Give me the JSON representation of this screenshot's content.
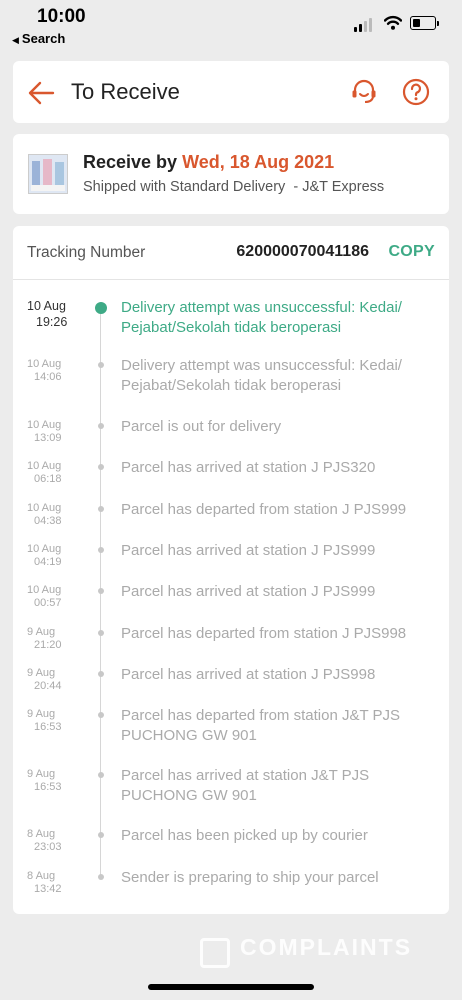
{
  "status_bar": {
    "time": "10:00",
    "back_app_label": "Search",
    "icons": [
      "cellular-signal-icon",
      "wifi-icon",
      "battery-icon"
    ]
  },
  "header": {
    "title": "To Receive",
    "back_icon": "back-arrow-icon",
    "chat_icon": "customer-service-headset-icon",
    "help_icon": "help-question-icon"
  },
  "receive": {
    "label": "Receive by",
    "date": "Wed, 18 Aug 2021",
    "shipping": "Shipped with Standard Delivery  - J&T Express"
  },
  "tracking": {
    "label": "Tracking Number",
    "number": "620000070041186",
    "copy_label": "COPY",
    "events": [
      {
        "date": "10 Aug",
        "time": "19:26",
        "text": "Delivery attempt was unsuccessful: Kedai/ Pejabat/Sekolah tidak beroperasi"
      },
      {
        "date": "10 Aug",
        "time": "14:06",
        "text": "Delivery attempt was unsuccessful: Kedai/ Pejabat/Sekolah tidak beroperasi"
      },
      {
        "date": "10 Aug",
        "time": "13:09",
        "text": "Parcel is out for delivery"
      },
      {
        "date": "10 Aug",
        "time": "06:18",
        "text": "Parcel has arrived at station J PJS320"
      },
      {
        "date": "10 Aug",
        "time": "04:38",
        "text": "Parcel has departed from station J PJS999"
      },
      {
        "date": "10 Aug",
        "time": "04:19",
        "text": "Parcel has arrived at station J PJS999"
      },
      {
        "date": "10 Aug",
        "time": "00:57",
        "text": "Parcel has arrived at station J PJS999"
      },
      {
        "date": "9 Aug",
        "time": "21:20",
        "text": "Parcel has departed from station J PJS998"
      },
      {
        "date": "9 Aug",
        "time": "20:44",
        "text": "Parcel has arrived at station J PJS998"
      },
      {
        "date": "9 Aug",
        "time": "16:53",
        "text": "Parcel has departed from station J&T PJS PUCHONG GW 901"
      },
      {
        "date": "9 Aug",
        "time": "16:53",
        "text": "Parcel has arrived at station J&T PJS PUCHONG GW 901"
      },
      {
        "date": "8 Aug",
        "time": "23:03",
        "text": "Parcel has been picked up by courier"
      },
      {
        "date": "8 Aug",
        "time": "13:42",
        "text": "Sender is preparing to ship your parcel"
      }
    ]
  },
  "colors": {
    "accent_orange": "#d9572e",
    "accent_green": "#3eaa86",
    "muted_text": "#aaaaaa",
    "background": "#ececec"
  },
  "watermark": {
    "text": "COMPLAINTS"
  }
}
